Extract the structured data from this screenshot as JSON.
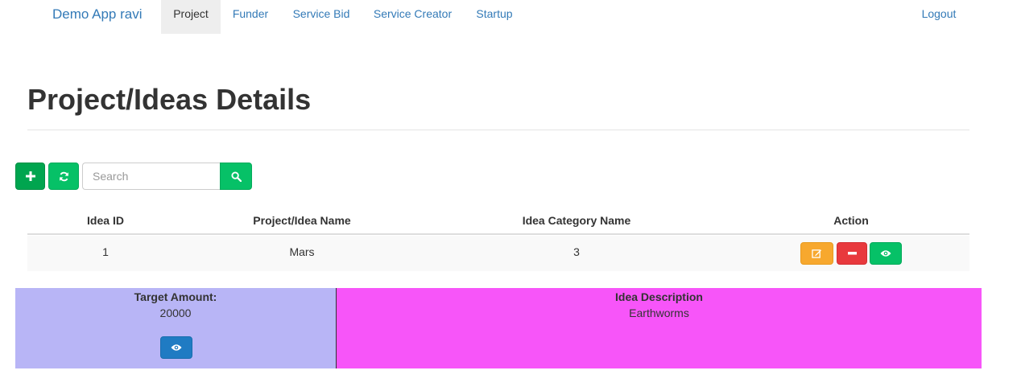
{
  "navbar": {
    "brand": "Demo App ravi",
    "items": [
      {
        "label": "Project",
        "active": true
      },
      {
        "label": "Funder",
        "active": false
      },
      {
        "label": "Service Bid",
        "active": false
      },
      {
        "label": "Service Creator",
        "active": false
      },
      {
        "label": "Startup",
        "active": false
      }
    ],
    "logout": "Logout"
  },
  "page": {
    "title": "Project/Ideas Details"
  },
  "toolbar": {
    "add_icon": "plus-icon",
    "refresh_icon": "refresh-icon",
    "search_placeholder": "Search",
    "search_value": "",
    "search_icon": "search-icon"
  },
  "table": {
    "columns": [
      "Idea ID",
      "Project/Idea Name",
      "Idea Category Name",
      "Action"
    ],
    "rows": [
      {
        "id": "1",
        "name": "Mars",
        "category": "3",
        "actions": [
          "edit-icon",
          "minus-icon",
          "eye-icon"
        ]
      }
    ]
  },
  "details": {
    "target_label": "Target Amount:",
    "target_value": "20000",
    "description_label": "Idea Description",
    "description_value": "Earthworms"
  },
  "colors": {
    "link": "#337ab7",
    "success": "#06c167",
    "warning": "#f7a82e",
    "danger": "#e8393d",
    "primary": "#1f7bc3",
    "panel_left": "#b8b5f6",
    "panel_right": "#f755f9"
  }
}
